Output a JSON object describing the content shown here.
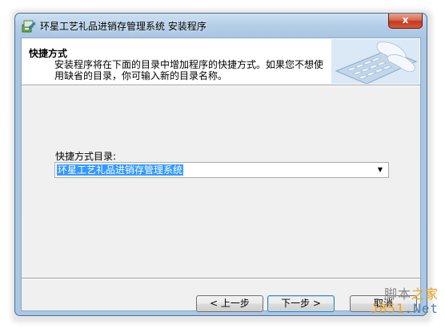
{
  "window": {
    "title": "环星工艺礼品进销存管理系统 安装程序",
    "close_label": "x"
  },
  "header": {
    "title": "快捷方式",
    "description": "安装程序将在下面的目录中增加程序的快捷方式。如果您不想使用缺省的目录，你可输入新的目录名称。"
  },
  "shortcut": {
    "label": "快捷方式目录:",
    "value": "环星工艺礼品进销存管理系统"
  },
  "buttons": {
    "back": "< 上一步",
    "next": "下一步 >",
    "cancel": "取消"
  },
  "watermark": {
    "line1_part1": "脚本",
    "line1_part2": "之家",
    "line2_part1": "JB51",
    "line2_part2": ".Net"
  },
  "icons": [
    "app-setup-icon",
    "close-icon",
    "dropdown-arrow-icon",
    "keyboard-hands-image"
  ]
}
